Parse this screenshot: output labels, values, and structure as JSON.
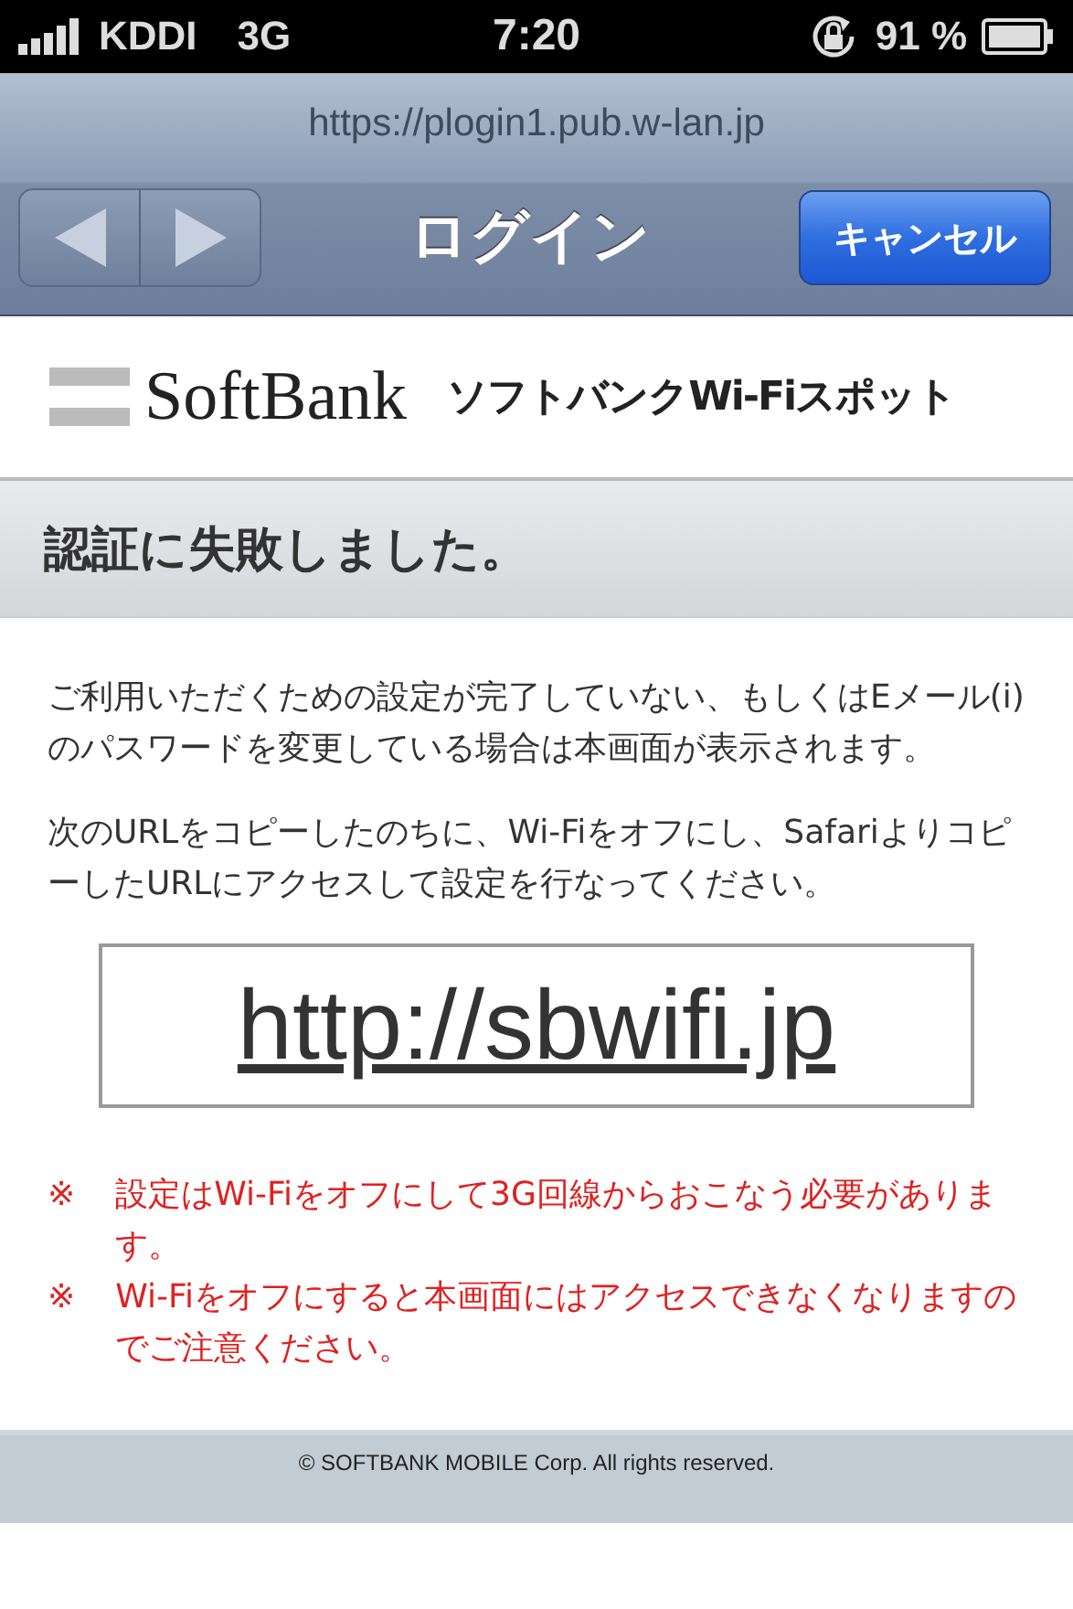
{
  "status_bar": {
    "carrier": "KDDI",
    "network": "3G",
    "time": "7:20",
    "battery": "91 %"
  },
  "browser": {
    "url": "https://plogin1.pub.w-lan.jp",
    "title": "ログイン",
    "cancel": "キャンセル"
  },
  "header": {
    "brand": "SoftBank",
    "service": "ソフトバンクWi-Fiスポット"
  },
  "heading": "認証に失敗しました。",
  "paragraphs": [
    "ご利用いただくための設定が完了していない、もしくはEメール(i)のパスワードを変更している場合は本画面が表示されます。",
    "次のURLをコピーしたのちに、Wi-Fiをオフにし、SafariよりコピーしたURLにアクセスして設定を行なってください。"
  ],
  "link": "http://sbwifi.jp",
  "notes": [
    {
      "mark": "※",
      "text": "設定はWi-Fiをオフにして3G回線からおこなう必要があります。"
    },
    {
      "mark": "※",
      "text": "Wi-Fiをオフにすると本画面にはアクセスできなくなりますのでご注意ください。"
    }
  ],
  "footer": "© SOFTBANK MOBILE Corp. All rights reserved."
}
